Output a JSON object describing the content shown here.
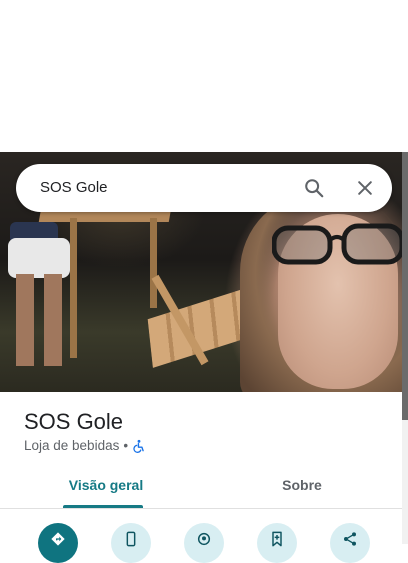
{
  "search": {
    "query": "SOS Gole",
    "search_icon": "search-icon",
    "close_icon": "close-icon"
  },
  "place": {
    "name": "SOS Gole",
    "category": "Loja de bebidas",
    "separator": "•",
    "accessibility_icon": "wheelchair-icon"
  },
  "tabs": [
    {
      "label": "Visão geral",
      "active": true
    },
    {
      "label": "Sobre",
      "active": false
    }
  ],
  "actions": [
    {
      "icon": "directions-icon"
    },
    {
      "icon": "phone-icon"
    },
    {
      "icon": "location-icon"
    },
    {
      "icon": "save-icon"
    },
    {
      "icon": "share-icon"
    }
  ],
  "colors": {
    "accent": "#167a85",
    "primary_action": "#0f7480",
    "secondary_action": "#d8eef2",
    "accessibility": "#1a73e8"
  }
}
